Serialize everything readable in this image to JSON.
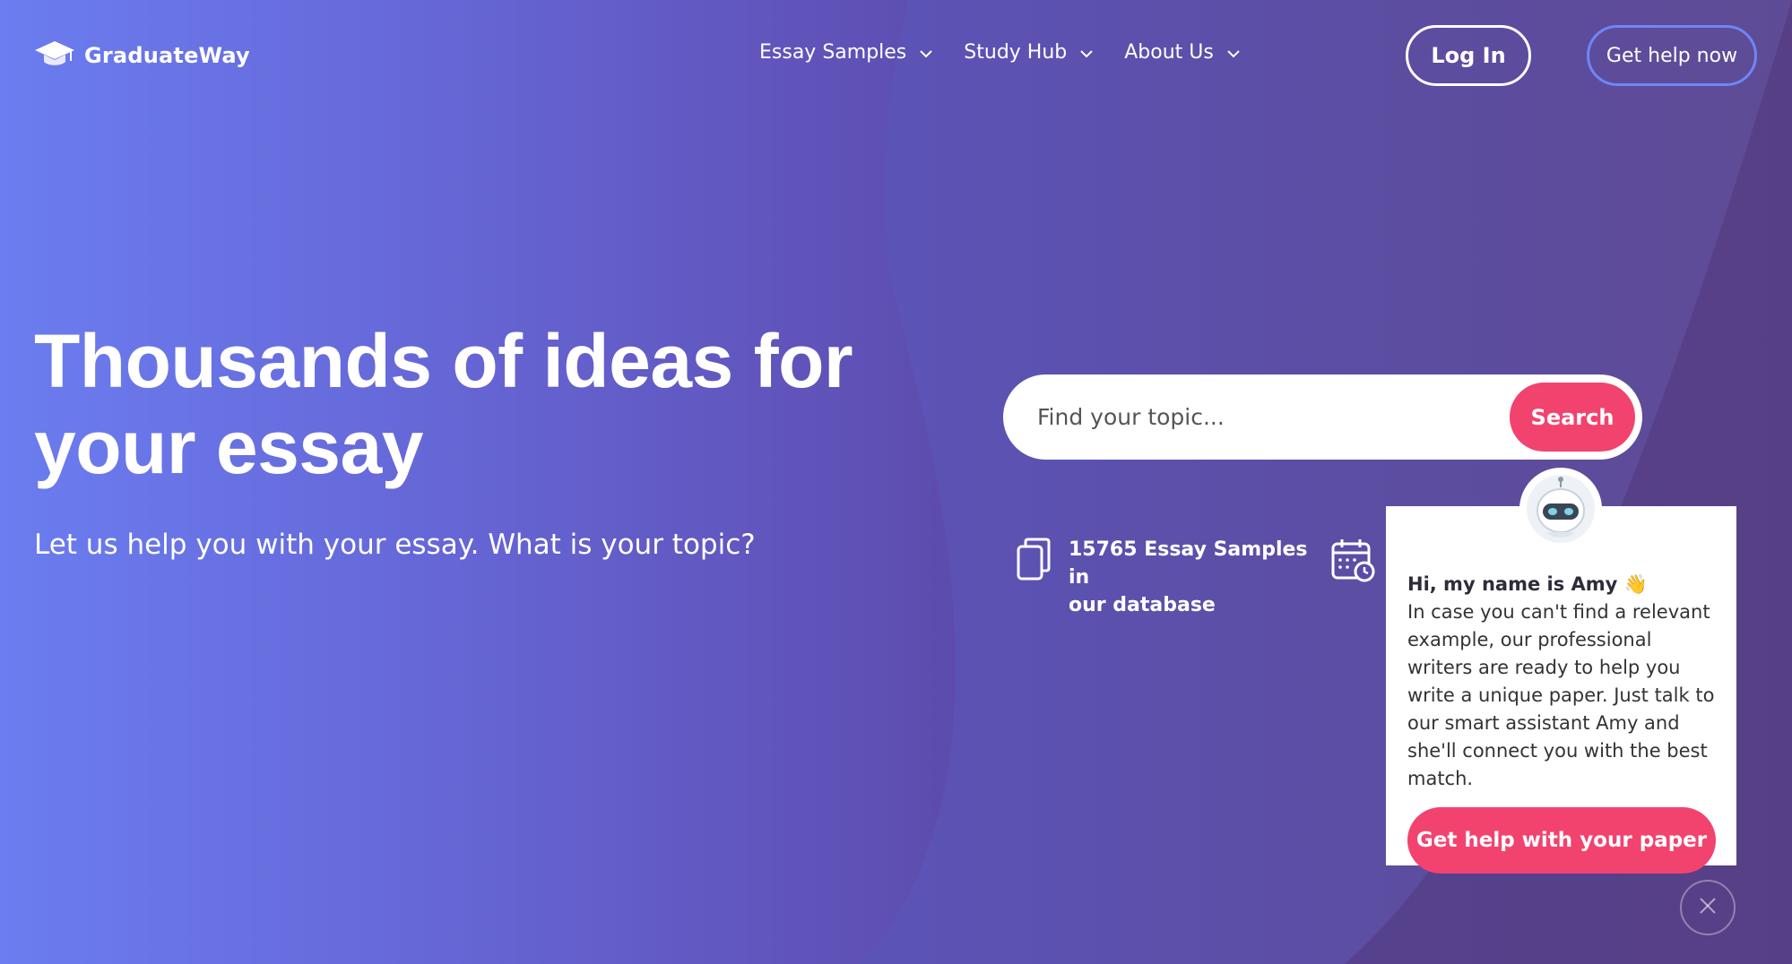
{
  "brand": {
    "name": "GraduateWay",
    "logo_icon": "graduation-cap-icon"
  },
  "nav": {
    "items": [
      {
        "label": "Essay Samples",
        "icon": "chevron-down-icon"
      },
      {
        "label": "Study Hub",
        "icon": "chevron-down-icon"
      },
      {
        "label": "About Us",
        "icon": "chevron-down-icon"
      }
    ]
  },
  "header": {
    "login_label": "Log In",
    "get_help_label": "Get help now"
  },
  "hero": {
    "title_line1": "Thousands of ideas for",
    "title_line2": "your essay",
    "subtitle": "Let us help you with your essay. What is your topic?"
  },
  "search": {
    "placeholder": "Find your topic...",
    "button_label": "Search"
  },
  "stats": {
    "line1": "15765 Essay Samples in",
    "line2": "our database",
    "icons": [
      "document-copy-icon",
      "calendar-clock-icon"
    ]
  },
  "assistant": {
    "greeting": "Hi, my name is Amy 👋",
    "body": "In case you can't find a relevant example, our professional writers are ready to help you write a unique paper. Just talk to our smart assistant Amy and she'll connect you with the best match.",
    "button_label": "Get help with your paper",
    "avatar_icon": "robot-avatar-icon",
    "close_icon": "close-icon"
  },
  "colors": {
    "accent": "#f2436f",
    "outline_button": "#6e86f5",
    "gradient_start": "#6b7df0",
    "gradient_end": "#4a2b66"
  }
}
